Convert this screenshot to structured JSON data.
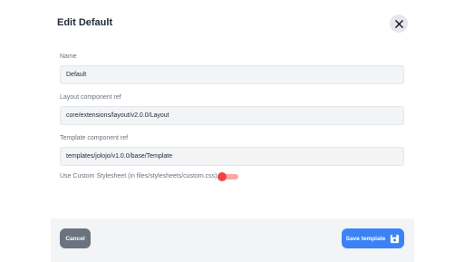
{
  "dialog": {
    "title": "Edit Default",
    "close_icon": "close-icon"
  },
  "fields": {
    "name": {
      "label": "Name",
      "value": "Default"
    },
    "layout_ref": {
      "label": "Layout component ref",
      "value": "core/extensions/layout/v2.0.0/Layout"
    },
    "template_ref": {
      "label": "Template component ref",
      "value": "templates/jolojo/v1.0.0/base/Template"
    }
  },
  "custom_stylesheet": {
    "label": "Use Custom Stylesheet (in files/stylesheets/custom.css)",
    "enabled": false
  },
  "footer": {
    "cancel_label": "Cancel",
    "save_label": "Save template",
    "save_icon": "save-icon"
  },
  "colors": {
    "primary": "#3b82f6",
    "cancel": "#6b7280",
    "toggle_thumb": "#ef4444",
    "toggle_track": "#fca5a5"
  }
}
